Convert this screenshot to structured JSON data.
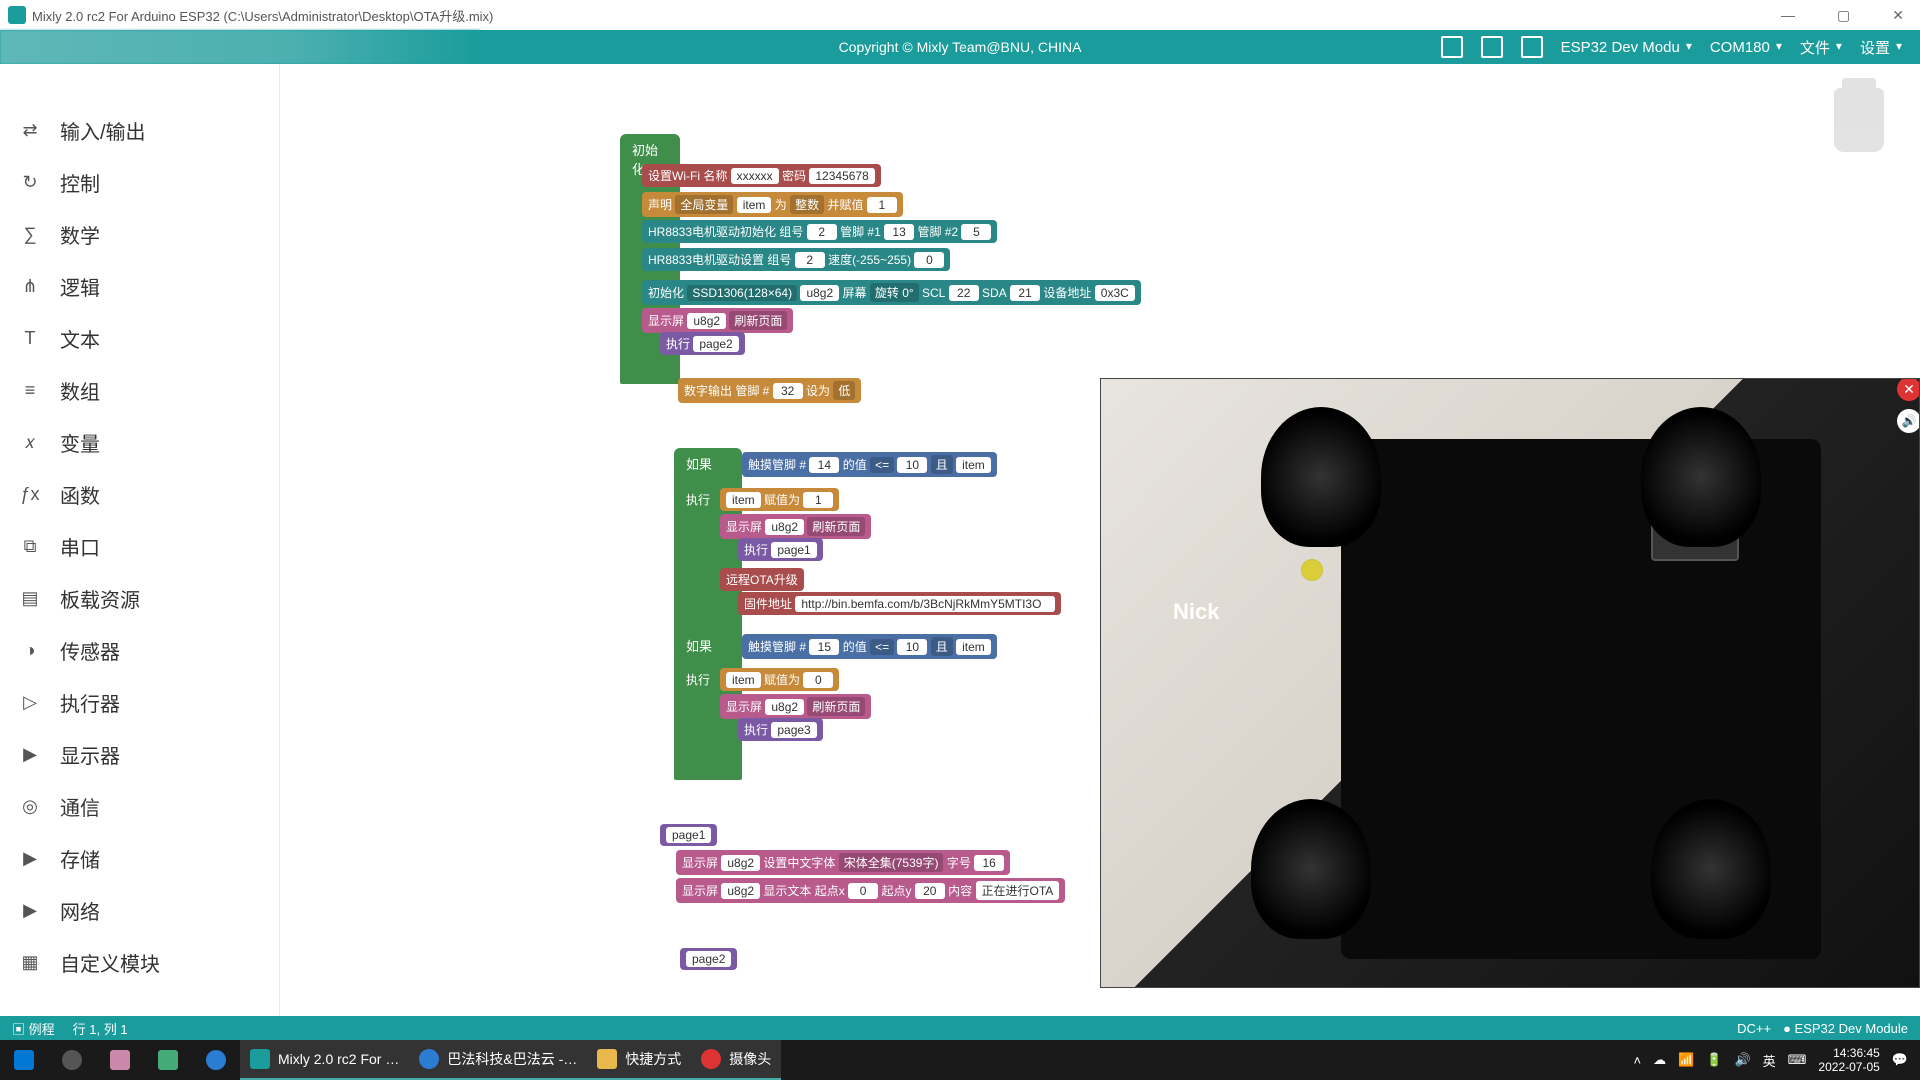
{
  "window": {
    "title": "Mixly 2.0 rc2 For Arduino ESP32 (C:\\Users\\Administrator\\Desktop\\OTA升级.mix)"
  },
  "menubar": {
    "copyright": "Copyright © Mixly Team@BNU, CHINA",
    "board": "ESP32 Dev Modu",
    "port": "COM180",
    "file": "文件",
    "settings": "设置"
  },
  "sidebar": {
    "items": [
      {
        "label": "输入/输出",
        "icon": "io-icon"
      },
      {
        "label": "控制",
        "icon": "control-icon"
      },
      {
        "label": "数学",
        "icon": "math-icon"
      },
      {
        "label": "逻辑",
        "icon": "logic-icon"
      },
      {
        "label": "文本",
        "icon": "text-icon"
      },
      {
        "label": "数组",
        "icon": "array-icon"
      },
      {
        "label": "变量",
        "icon": "variable-icon"
      },
      {
        "label": "函数",
        "icon": "function-icon"
      },
      {
        "label": "串口",
        "icon": "serial-icon"
      },
      {
        "label": "板载资源",
        "icon": "board-icon"
      },
      {
        "label": "传感器",
        "icon": "sensor-icon"
      },
      {
        "label": "执行器",
        "icon": "actuator-icon"
      },
      {
        "label": "显示器",
        "icon": "display-icon"
      },
      {
        "label": "通信",
        "icon": "comm-icon"
      },
      {
        "label": "存储",
        "icon": "storage-icon"
      },
      {
        "label": "网络",
        "icon": "network-icon"
      },
      {
        "label": "自定义模块",
        "icon": "custom-icon"
      }
    ]
  },
  "blocks": {
    "init_header": "初始化",
    "wifi": {
      "label": "设置Wi-Fi 名称",
      "ssid": "xxxxxx",
      "pw_label": "密码",
      "pw": "12345678"
    },
    "declare": {
      "label": "声明",
      "scope": "全局变量",
      "var": "item",
      "as": "为",
      "type": "整数",
      "assign": "并赋值",
      "val": "1"
    },
    "hr8833_init": {
      "label": "HR8833电机驱动初始化 组号",
      "group": "2",
      "pin1_label": "管脚 #1",
      "pin1": "13",
      "pin2_label": "管脚 #2",
      "pin2": "5"
    },
    "hr8833_set": {
      "label": "HR8833电机驱动设置 组号",
      "group": "2",
      "speed_label": "速度(-255~255)",
      "speed": "0"
    },
    "ssd1306": {
      "label": "初始化",
      "model": "SSD1306(128×64)",
      "bus": "u8g2",
      "rot_label": "屏幕",
      "rot": "旋转 0°",
      "scl_label": "SCL",
      "scl": "22",
      "sda_label": "SDA",
      "sda": "21",
      "addr_label": "设备地址",
      "addr": "0x3C"
    },
    "disp_refresh": {
      "label": "显示屏",
      "bus": "u8g2",
      "action": "刷新页面"
    },
    "exec_page2": {
      "label": "执行",
      "page": "page2"
    },
    "digital_out": {
      "label": "数字输出 管脚 #",
      "pin": "32",
      "set": "设为",
      "level": "低"
    },
    "if1": {
      "if": "如果",
      "exec": "执行",
      "touch": {
        "label": "触摸管脚 #",
        "pin": "14",
        "val_label": "的值",
        "op": "<=",
        "threshold": "10",
        "and": "且",
        "var": "item"
      },
      "assign": {
        "var": "item",
        "label": "赋值为",
        "val": "1"
      },
      "disp": {
        "label": "显示屏",
        "bus": "u8g2",
        "action": "刷新页面"
      },
      "exec_page": {
        "label": "执行",
        "page": "page1"
      },
      "ota": {
        "label": "远程OTA升级",
        "fw_label": "固件地址",
        "url": "http://bin.bemfa.com/b/3BcNjRkMmY5MTI3O"
      }
    },
    "if2": {
      "if": "如果",
      "exec": "执行",
      "touch": {
        "label": "触摸管脚 #",
        "pin": "15",
        "val_label": "的值",
        "op": "<=",
        "threshold": "10",
        "and": "且",
        "var": "item"
      },
      "assign": {
        "var": "item",
        "label": "赋值为",
        "val": "0"
      },
      "disp": {
        "label": "显示屏",
        "bus": "u8g2",
        "action": "刷新页面"
      },
      "exec_page": {
        "label": "执行",
        "page": "page3"
      }
    },
    "page1": {
      "name": "page1",
      "font": {
        "label": "显示屏",
        "bus": "u8g2",
        "set": "设置中文字体",
        "font": "宋体全集(7539字)",
        "size_label": "字号",
        "size": "16"
      },
      "text": {
        "label": "显示屏",
        "bus": "u8g2",
        "act": "显示文本 起点x",
        "x": "0",
        "y_label": "起点y",
        "y": "20",
        "content_label": "内容",
        "content": "正在进行OTA"
      }
    },
    "page2": {
      "name": "page2"
    }
  },
  "statusbar": {
    "mode": "例程",
    "cursor": "行 1, 列 1",
    "lang": "DC++",
    "board": "ESP32 Dev Module"
  },
  "webcam": {
    "label": "Nick"
  },
  "taskbar": {
    "items": [
      {
        "label": "",
        "icon": "windows-icon"
      },
      {
        "label": "",
        "icon": "copilot-icon"
      },
      {
        "label": "",
        "icon": "paint-icon"
      },
      {
        "label": "",
        "icon": "calc-icon"
      },
      {
        "label": "",
        "icon": "edge-icon"
      },
      {
        "label": "Mixly 2.0 rc2 For …",
        "icon": "mixly-icon"
      },
      {
        "label": "巴法科技&巴法云 -…",
        "icon": "edge2-icon"
      },
      {
        "label": "快捷方式",
        "icon": "folder-icon"
      },
      {
        "label": "摄像头",
        "icon": "camera-icon"
      }
    ],
    "ime": "英",
    "time": "14:36:45",
    "date": "2022-07-05"
  }
}
